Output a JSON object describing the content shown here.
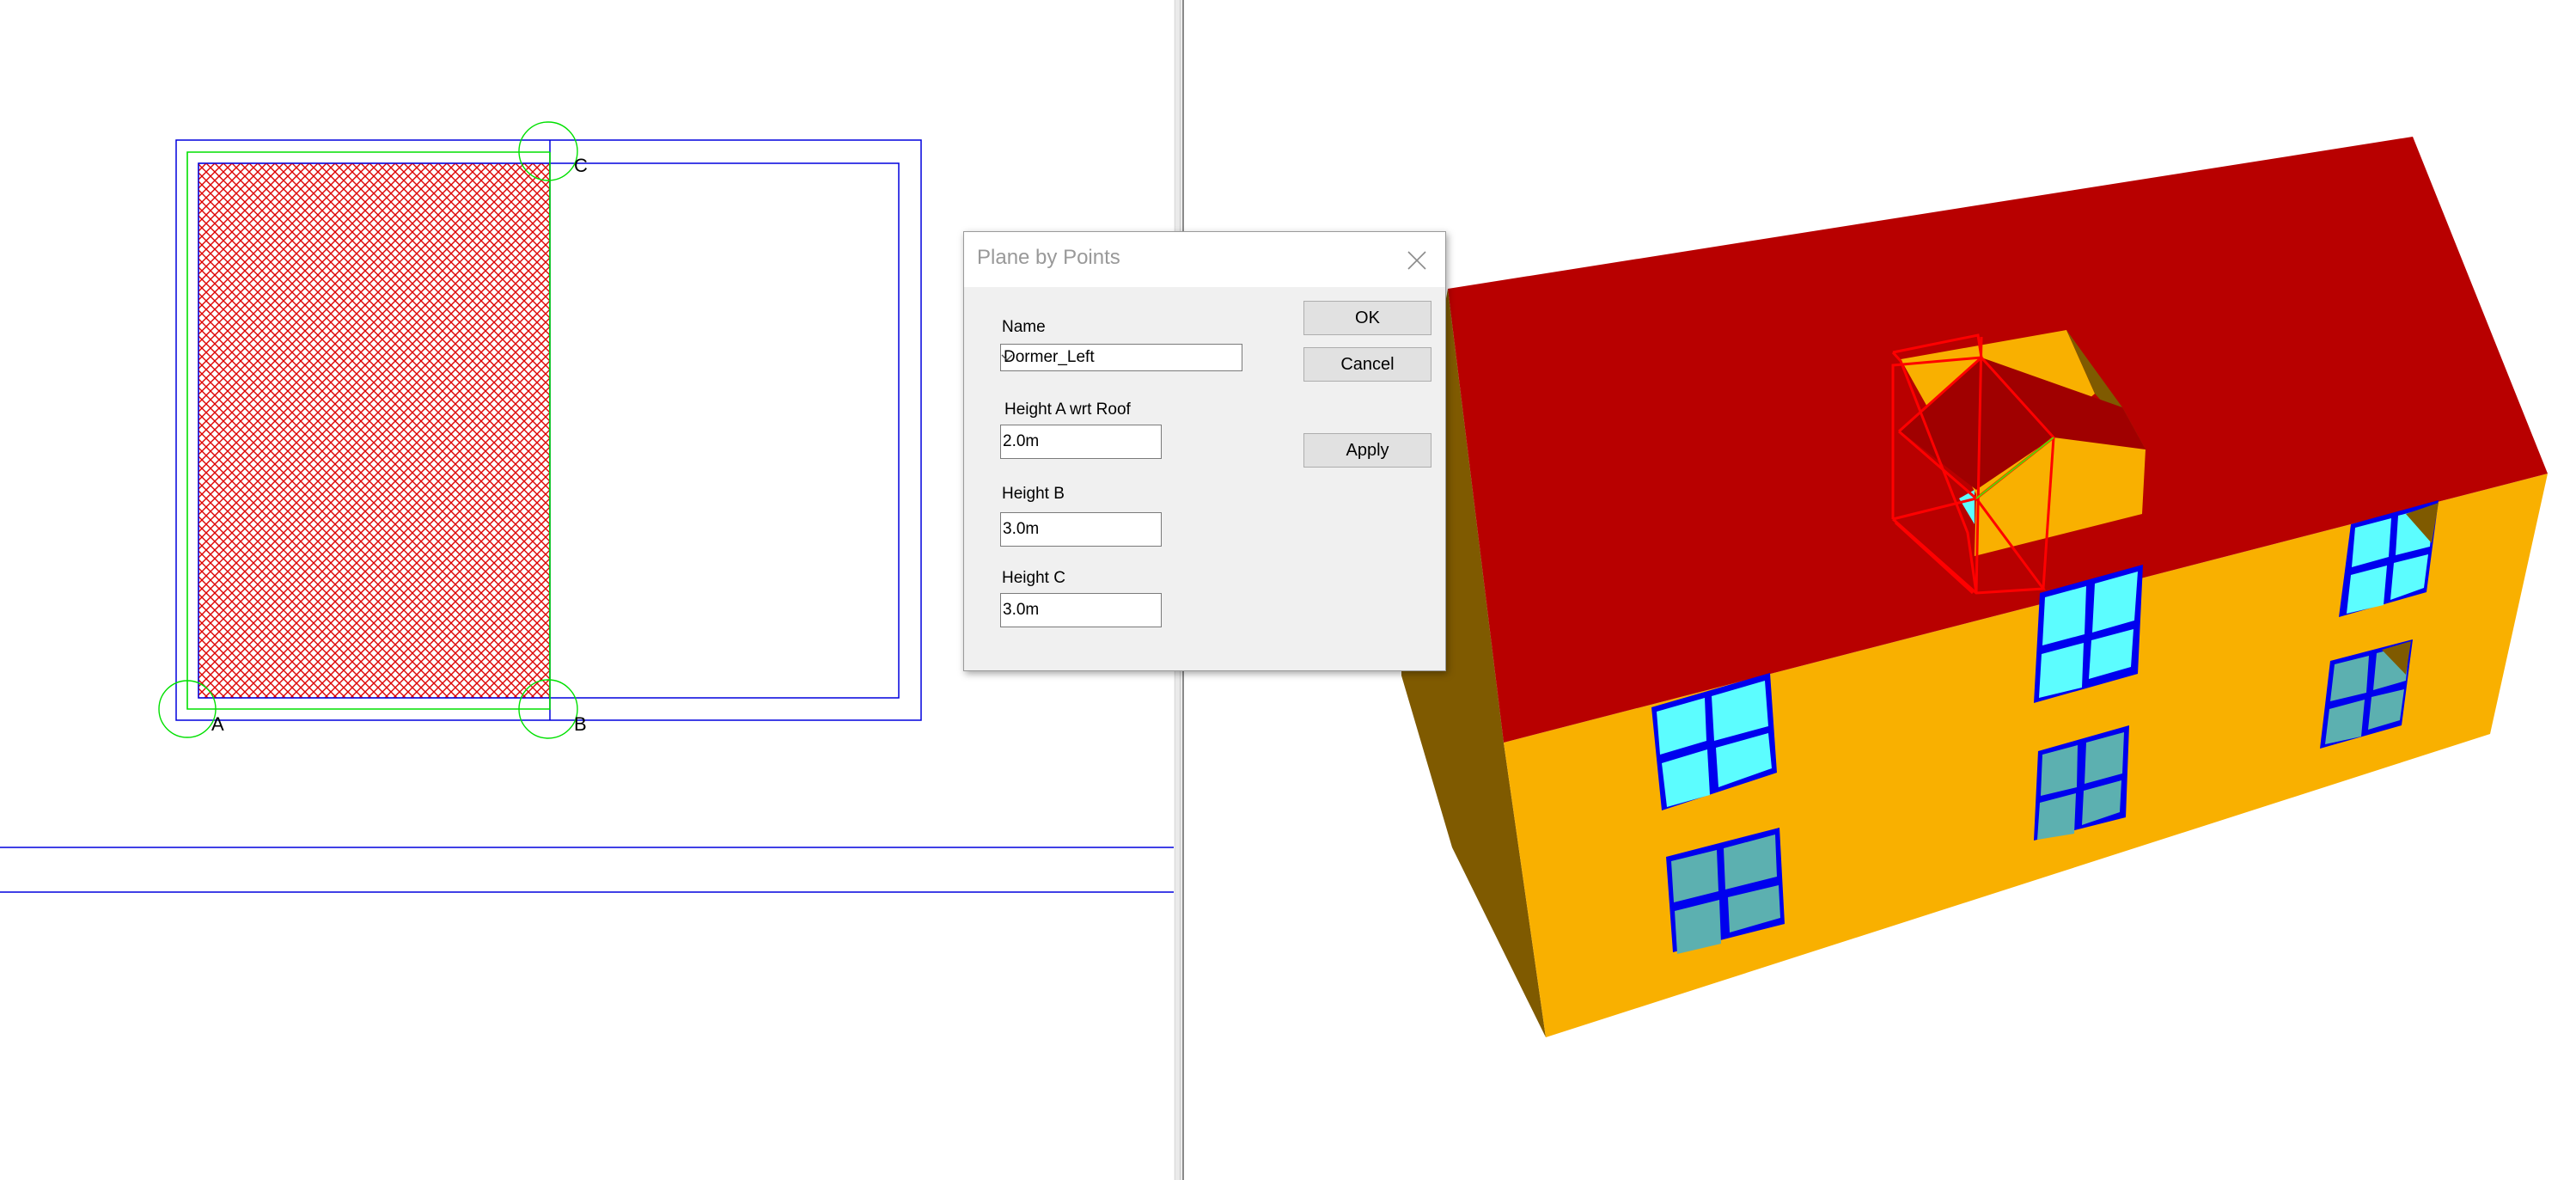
{
  "plan_view": {
    "point_labels": {
      "a": "A",
      "b": "B",
      "c": "C"
    },
    "colors": {
      "outline": "#0000dd",
      "selection": "#00e000",
      "hatch": "#dd0000"
    }
  },
  "view3d": {
    "colors": {
      "roof": "#b80000",
      "roof_shadow": "#a00000",
      "wall": "#f9b000",
      "wall_shadow": "#7f5a00",
      "window_frame": "#0000ee",
      "glass_upper": "#5cfdff",
      "glass_lower": "#5cb0b0",
      "wireframe": "#ff0000"
    }
  },
  "dialog": {
    "title": "Plane by Points",
    "fields": {
      "name_label": "Name",
      "name_value": "Dormer_Left",
      "height_a_label": "Height A wrt Roof",
      "height_a_value": "2.0m",
      "height_b_label": "Height B",
      "height_b_value": "3.0m",
      "height_c_label": "Height C",
      "height_c_value": "3.0m"
    },
    "buttons": {
      "ok": "OK",
      "cancel": "Cancel",
      "apply": "Apply"
    }
  }
}
